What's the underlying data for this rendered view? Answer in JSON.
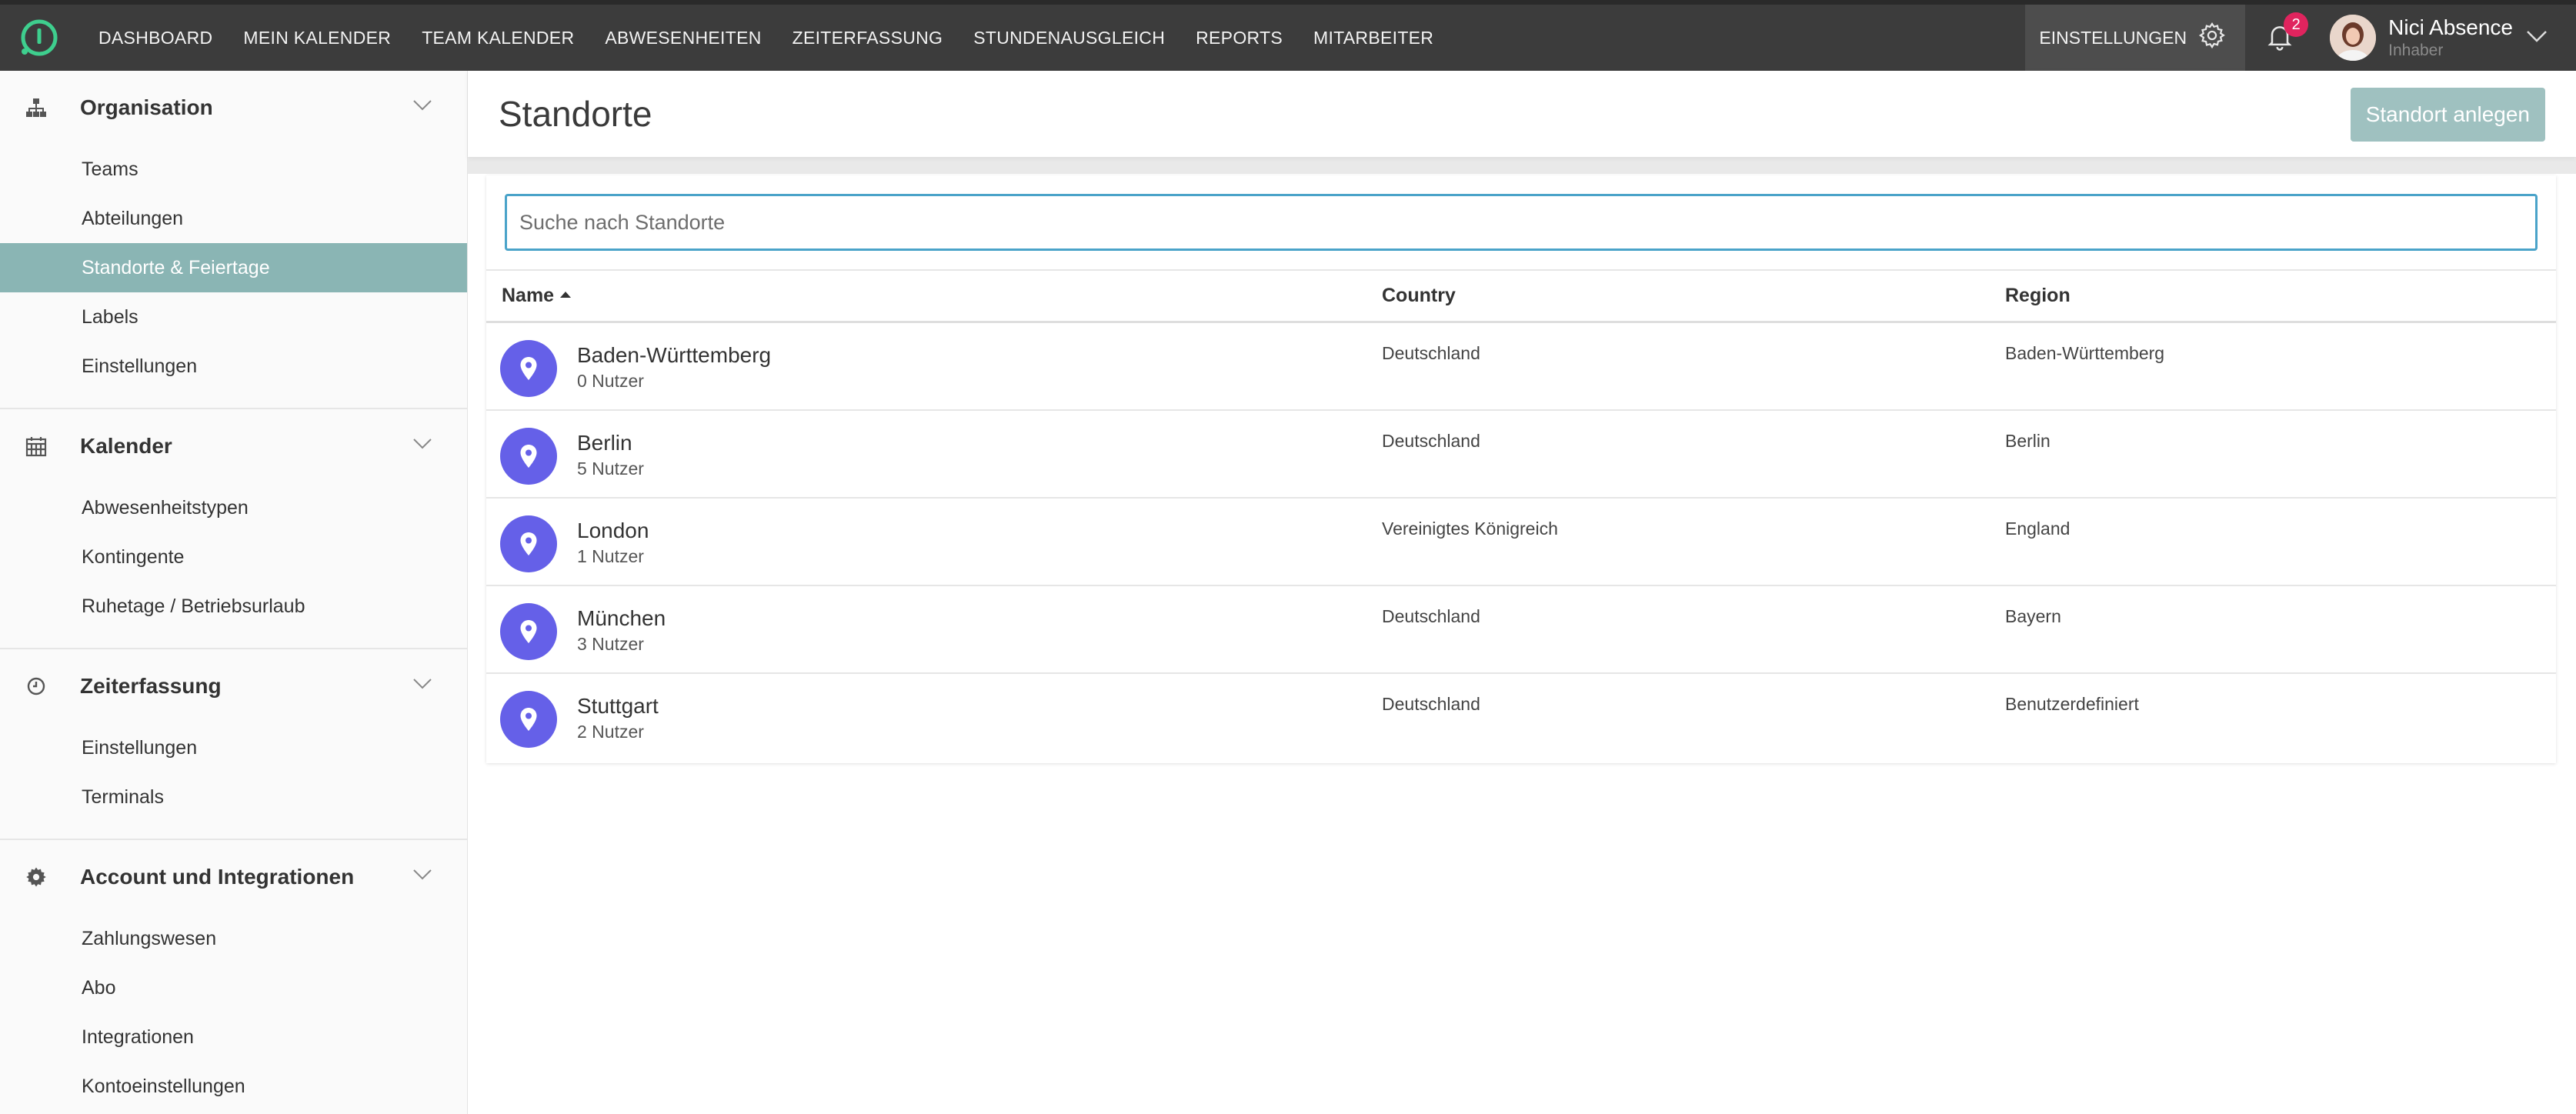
{
  "nav": {
    "items": [
      "DASHBOARD",
      "MEIN KALENDER",
      "TEAM KALENDER",
      "ABWESENHEITEN",
      "ZEITERFASSUNG",
      "STUNDENAUSGLEICH",
      "REPORTS",
      "MITARBEITER"
    ],
    "settings_label": "EINSTELLUNGEN",
    "notification_count": "2",
    "user_name": "Nici Absence",
    "user_role": "Inhaber"
  },
  "sidebar": {
    "groups": [
      {
        "title": "Organisation",
        "icon": "sitemap-icon",
        "items": [
          "Teams",
          "Abteilungen",
          "Standorte & Feiertage",
          "Labels",
          "Einstellungen"
        ]
      },
      {
        "title": "Kalender",
        "icon": "calendar-icon",
        "items": [
          "Abwesenheitstypen",
          "Kontingente",
          "Ruhetage / Betriebsurlaub"
        ]
      },
      {
        "title": "Zeiterfassung",
        "icon": "clock-icon",
        "items": [
          "Einstellungen",
          "Terminals"
        ]
      },
      {
        "title": "Account und Integrationen",
        "icon": "gear-icon",
        "items": [
          "Zahlungswesen",
          "Abo",
          "Integrationen",
          "Kontoeinstellungen"
        ]
      }
    ],
    "active_item": "Standorte & Feiertage"
  },
  "main": {
    "title": "Standorte",
    "create_button": "Standort anlegen",
    "search_placeholder": "Suche nach Standorte",
    "columns": [
      "Name",
      "Country",
      "Region"
    ],
    "rows": [
      {
        "name": "Baden-Württemberg",
        "users": "0 Nutzer",
        "country": "Deutschland",
        "region": "Baden-Württemberg"
      },
      {
        "name": "Berlin",
        "users": "5 Nutzer",
        "country": "Deutschland",
        "region": "Berlin"
      },
      {
        "name": "London",
        "users": "1 Nutzer",
        "country": "Vereinigtes Königreich",
        "region": "England"
      },
      {
        "name": "München",
        "users": "3 Nutzer",
        "country": "Deutschland",
        "region": "Bayern"
      },
      {
        "name": "Stuttgart",
        "users": "2 Nutzer",
        "country": "Deutschland",
        "region": "Benutzerdefiniert"
      }
    ]
  },
  "colors": {
    "topbar": "#3c3c3c",
    "active_sidebar": "#8ab5b4",
    "pin_circle": "#6560e8",
    "create_button": "#9fc1c0",
    "badge": "#e0245e",
    "logo": "#3ecf8e"
  }
}
